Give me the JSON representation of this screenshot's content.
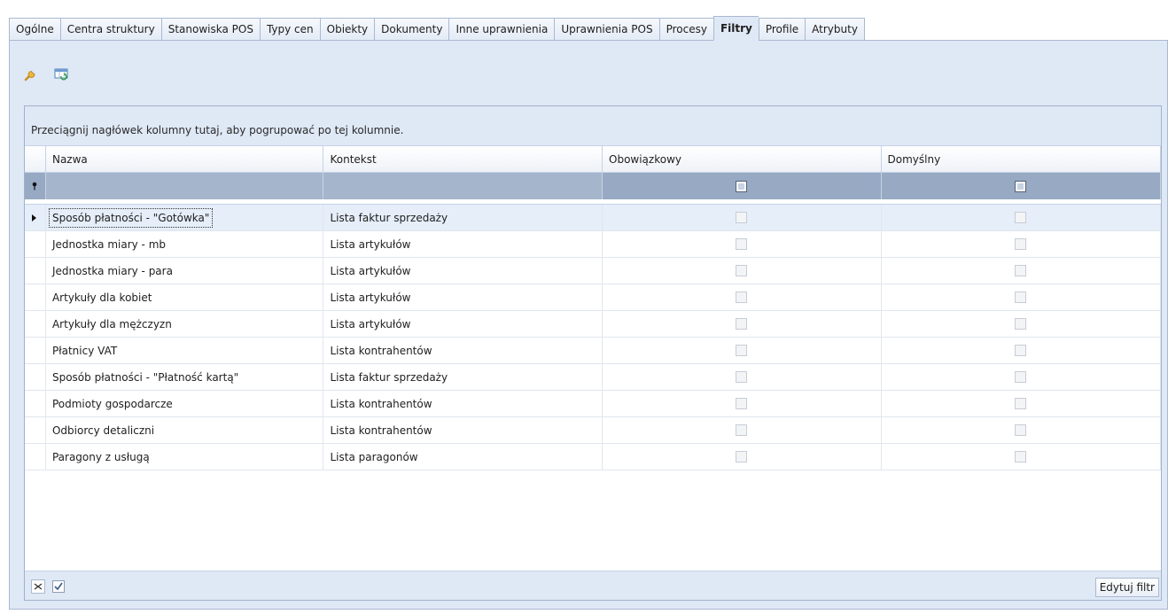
{
  "tabs": [
    {
      "label": "Ogólne"
    },
    {
      "label": "Centra struktury"
    },
    {
      "label": "Stanowiska POS"
    },
    {
      "label": "Typy cen"
    },
    {
      "label": "Obiekty"
    },
    {
      "label": "Dokumenty"
    },
    {
      "label": "Inne uprawnienia"
    },
    {
      "label": "Uprawnienia POS"
    },
    {
      "label": "Procesy"
    },
    {
      "label": "Filtry",
      "active": true
    },
    {
      "label": "Profile"
    },
    {
      "label": "Atrybuty"
    }
  ],
  "toolbar": {
    "icons": [
      "wrench-icon",
      "refresh-grid-icon"
    ]
  },
  "grid": {
    "group_panel_text": "Przeciągnij nagłówek kolumny tutaj, aby pogrupować po tej kolumnie.",
    "columns": {
      "name": "Nazwa",
      "context": "Kontekst",
      "mandatory": "Obowiązkowy",
      "default": "Domyślny"
    },
    "rows": [
      {
        "name": "Sposób płatności - \"Gotówka\"",
        "context": "Lista faktur sprzedaży",
        "mandatory": false,
        "default": false,
        "selected": true
      },
      {
        "name": "Jednostka miary - mb",
        "context": "Lista artykułów",
        "mandatory": false,
        "default": false
      },
      {
        "name": "Jednostka miary - para",
        "context": "Lista artykułów",
        "mandatory": false,
        "default": false
      },
      {
        "name": "Artykuły dla kobiet",
        "context": "Lista artykułów",
        "mandatory": false,
        "default": false
      },
      {
        "name": "Artykuły dla mężczyzn",
        "context": "Lista artykułów",
        "mandatory": false,
        "default": false
      },
      {
        "name": "Płatnicy VAT",
        "context": "Lista kontrahentów",
        "mandatory": false,
        "default": false
      },
      {
        "name": "Sposób płatności - \"Płatność kartą\"",
        "context": "Lista faktur sprzedaży",
        "mandatory": false,
        "default": false
      },
      {
        "name": "Podmioty gospodarcze",
        "context": "Lista kontrahentów",
        "mandatory": false,
        "default": false
      },
      {
        "name": "Odbiorcy detaliczni",
        "context": "Lista kontrahentów",
        "mandatory": false,
        "default": false
      },
      {
        "name": "Paragony z usługą",
        "context": "Lista paragonów",
        "mandatory": false,
        "default": false
      }
    ]
  },
  "footer": {
    "edit_filter_label": "Edytuj filtr"
  }
}
